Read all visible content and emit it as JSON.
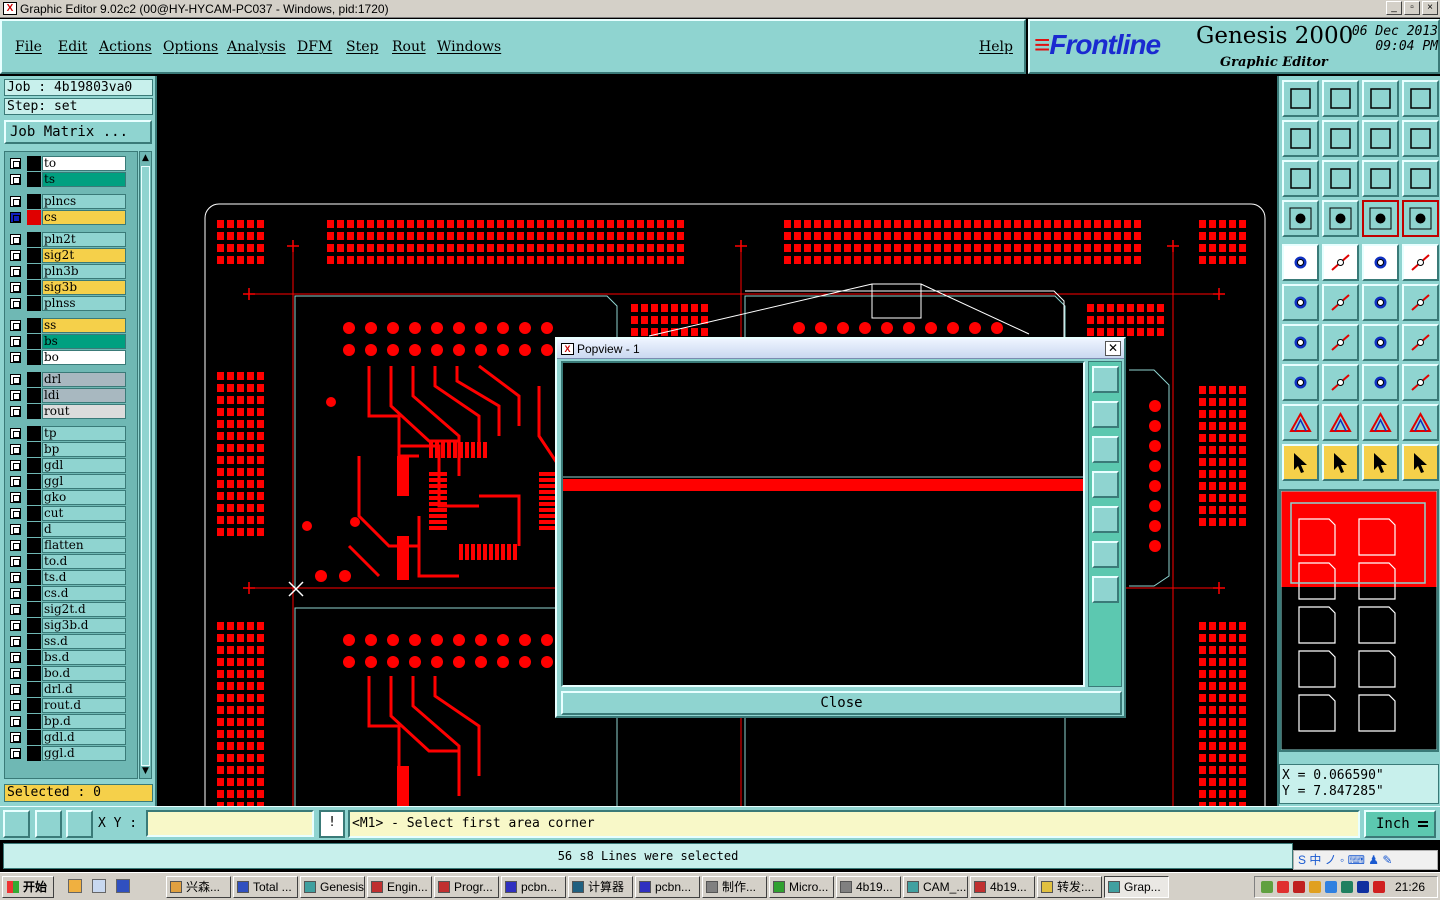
{
  "window": {
    "title": "Graphic Editor 9.02c2 (00@HY-HYCAM-PC037 - Windows, pid:1720)"
  },
  "menu": {
    "items": [
      "File",
      "Edit",
      "Actions",
      "Options",
      "Analysis",
      "DFM",
      "Step",
      "Rout",
      "Windows"
    ],
    "help": "Help"
  },
  "brand": {
    "logo": "Frontline",
    "product": "Genesis 2000",
    "date": "06 Dec 2013",
    "time": "09:04 PM",
    "subtitle": "Graphic Editor"
  },
  "job": {
    "job_label": "Job : 4b19803va0",
    "step_label": "Step: set",
    "matrix_button": "Job Matrix ..."
  },
  "layers": [
    {
      "name": "to",
      "color": "#ffffff",
      "swatch": "#000000"
    },
    {
      "name": "ts",
      "color": "#00a080",
      "swatch": "#000000"
    },
    {
      "name": "plncs",
      "color": "#8fd4d0",
      "swatch": "#000000"
    },
    {
      "name": "cs",
      "color": "#f5d04a",
      "swatch": "#e00000",
      "active": true
    },
    {
      "name": "pln2t",
      "color": "#8fd4d0",
      "swatch": "#000000"
    },
    {
      "name": "sig2t",
      "color": "#f5d04a",
      "swatch": "#000000"
    },
    {
      "name": "pln3b",
      "color": "#8fd4d0",
      "swatch": "#000000"
    },
    {
      "name": "sig3b",
      "color": "#f5d04a",
      "swatch": "#000000"
    },
    {
      "name": "plnss",
      "color": "#8fd4d0",
      "swatch": "#000000"
    },
    {
      "name": "ss",
      "color": "#f5d04a",
      "swatch": "#000000"
    },
    {
      "name": "bs",
      "color": "#00a080",
      "swatch": "#000000"
    },
    {
      "name": "bo",
      "color": "#ffffff",
      "swatch": "#000000"
    },
    {
      "name": "drl",
      "color": "#a8b8c0",
      "swatch": "#000000"
    },
    {
      "name": "ldi",
      "color": "#a8b8c0",
      "swatch": "#000000"
    },
    {
      "name": "rout",
      "color": "#dcdcdc",
      "swatch": "#000000"
    },
    {
      "name": "tp",
      "color": "#8fd4d0",
      "swatch": "#000000"
    },
    {
      "name": "bp",
      "color": "#8fd4d0",
      "swatch": "#000000"
    },
    {
      "name": "gdl",
      "color": "#8fd4d0",
      "swatch": "#000000"
    },
    {
      "name": "ggl",
      "color": "#8fd4d0",
      "swatch": "#000000"
    },
    {
      "name": "gko",
      "color": "#8fd4d0",
      "swatch": "#000000"
    },
    {
      "name": "cut",
      "color": "#8fd4d0",
      "swatch": "#000000"
    },
    {
      "name": "d",
      "color": "#8fd4d0",
      "swatch": "#000000"
    },
    {
      "name": "flatten",
      "color": "#8fd4d0",
      "swatch": "#000000"
    },
    {
      "name": "to.d",
      "color": "#8fd4d0",
      "swatch": "#000000"
    },
    {
      "name": "ts.d",
      "color": "#8fd4d0",
      "swatch": "#000000"
    },
    {
      "name": "cs.d",
      "color": "#8fd4d0",
      "swatch": "#000000"
    },
    {
      "name": "sig2t.d",
      "color": "#8fd4d0",
      "swatch": "#000000"
    },
    {
      "name": "sig3b.d",
      "color": "#8fd4d0",
      "swatch": "#000000"
    },
    {
      "name": "ss.d",
      "color": "#8fd4d0",
      "swatch": "#000000"
    },
    {
      "name": "bs.d",
      "color": "#8fd4d0",
      "swatch": "#000000"
    },
    {
      "name": "bo.d",
      "color": "#8fd4d0",
      "swatch": "#000000"
    },
    {
      "name": "drl.d",
      "color": "#8fd4d0",
      "swatch": "#000000"
    },
    {
      "name": "rout.d",
      "color": "#8fd4d0",
      "swatch": "#000000"
    },
    {
      "name": "bp.d",
      "color": "#8fd4d0",
      "swatch": "#000000"
    },
    {
      "name": "gdl.d",
      "color": "#8fd4d0",
      "swatch": "#000000"
    },
    {
      "name": "ggl.d",
      "color": "#8fd4d0",
      "swatch": "#000000"
    }
  ],
  "selected_label": "Selected : 0",
  "popview": {
    "title": "Popview - 1",
    "close_label": "Close"
  },
  "coords": {
    "x": "X = 0.066590\"",
    "y": "Y = 7.847285\""
  },
  "command": {
    "xy_label": "X Y :",
    "xy_value": "",
    "prompt_button": "!",
    "prompt": "<M1> - Select first area corner",
    "unit": "Inch"
  },
  "status": "56 s8 Lines were selected",
  "ime": "S 中 ノ ◦ ⌨ ♟ ✎",
  "taskbar": {
    "start": "开始",
    "tasks": [
      "兴森...",
      "Total ...",
      "Genesis",
      "Engin...",
      "Progr...",
      "pcbn...",
      "计算器",
      "pcbn...",
      "制作...",
      "Micro...",
      "4b19...",
      "CAM_...",
      "4b19...",
      "转发:...",
      "Grap..."
    ],
    "clock": "21:26"
  },
  "colors": {
    "copper": "#ff0000",
    "panel": "#8fd4d0",
    "outline": "#8fd4d0"
  }
}
